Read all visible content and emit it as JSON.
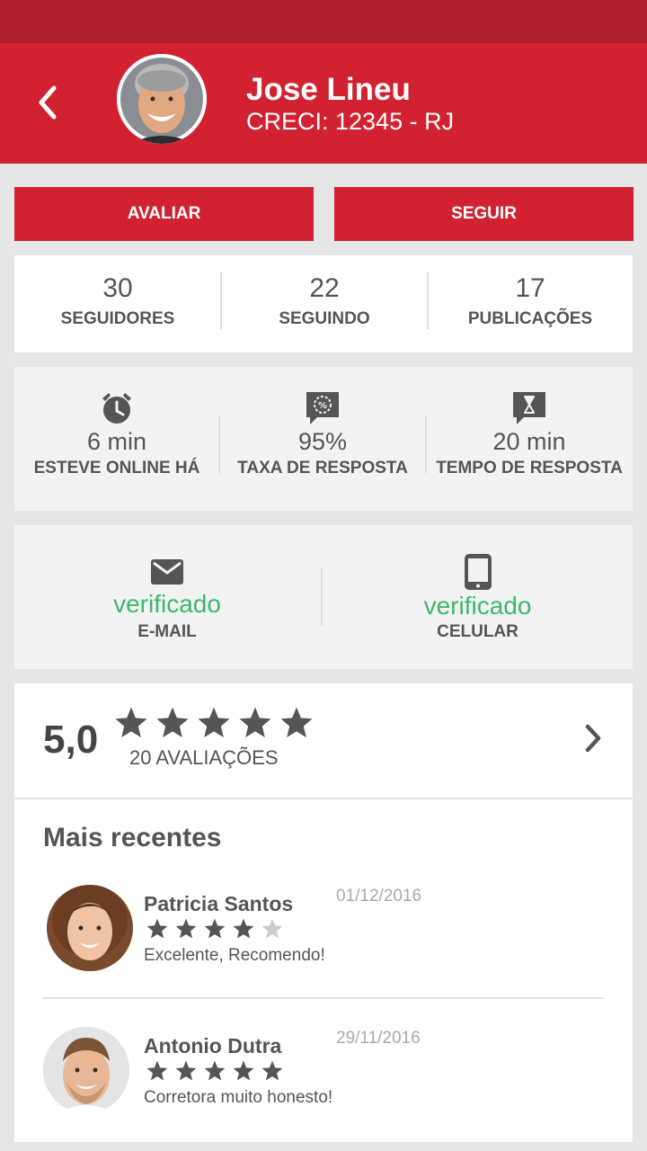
{
  "profile": {
    "name": "Jose Lineu",
    "creci": "CRECI: 12345 - RJ"
  },
  "actions": {
    "avaliar_label": "AVALIAR",
    "seguir_label": "SEGUIR"
  },
  "stats": [
    {
      "value": "30",
      "label": "SEGUIDORES"
    },
    {
      "value": "22",
      "label": "SEGUINDO"
    },
    {
      "value": "17",
      "label": "PUBLICAÇÕES"
    }
  ],
  "metrics": [
    {
      "icon": "alarm-clock-icon",
      "value": "6 min",
      "label": "ESTEVE ONLINE HÁ"
    },
    {
      "icon": "percent-chat-icon",
      "value": "95%",
      "label": "TAXA DE RESPOSTA"
    },
    {
      "icon": "hourglass-chat-icon",
      "value": "20 min",
      "label": "TEMPO DE RESPOSTA"
    }
  ],
  "verifications": [
    {
      "icon": "mail-icon",
      "value": "verificado",
      "label": "E-MAIL"
    },
    {
      "icon": "phone-icon",
      "value": "verificado",
      "label": "CELULAR"
    }
  ],
  "rating": {
    "score": "5,0",
    "stars": 5,
    "count_label": "20 AVALIAÇÕES"
  },
  "recent": {
    "title": "Mais recentes",
    "reviews": [
      {
        "name": "Patricia Santos",
        "date": "01/12/2016",
        "stars": 4,
        "comment": "Excelente, Recomendo!"
      },
      {
        "name": "Antonio Dutra",
        "date": "29/11/2016",
        "stars": 5,
        "comment": "Corretora muito honesto!"
      }
    ]
  },
  "colors": {
    "primary": "#d22231",
    "statusbar": "#b01e2b",
    "verified": "#3cb96a",
    "star_filled": "#555555",
    "star_empty": "#cccccc"
  }
}
